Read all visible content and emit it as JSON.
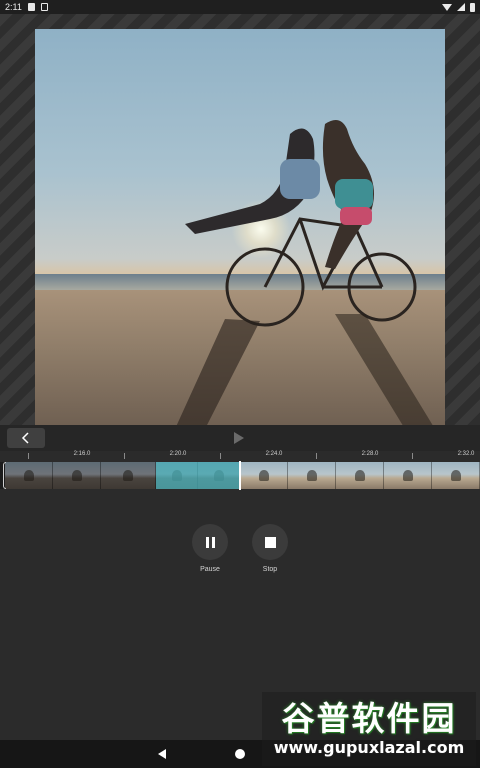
{
  "status_bar": {
    "time": "2:11"
  },
  "timeline": {
    "tick_labels": [
      "2:16.0",
      "2:20.0",
      "2:24.0",
      "2:28.0",
      "2:32.0"
    ]
  },
  "controls": {
    "pause_label": "Pause",
    "stop_label": "Stop"
  },
  "watermark": {
    "chinese": "谷普软件园",
    "url": "www.gupuxlazal.com"
  },
  "colors": {
    "background": "#2b2b2b",
    "selection": "#50c8d2",
    "button": "#3b3b3b"
  }
}
